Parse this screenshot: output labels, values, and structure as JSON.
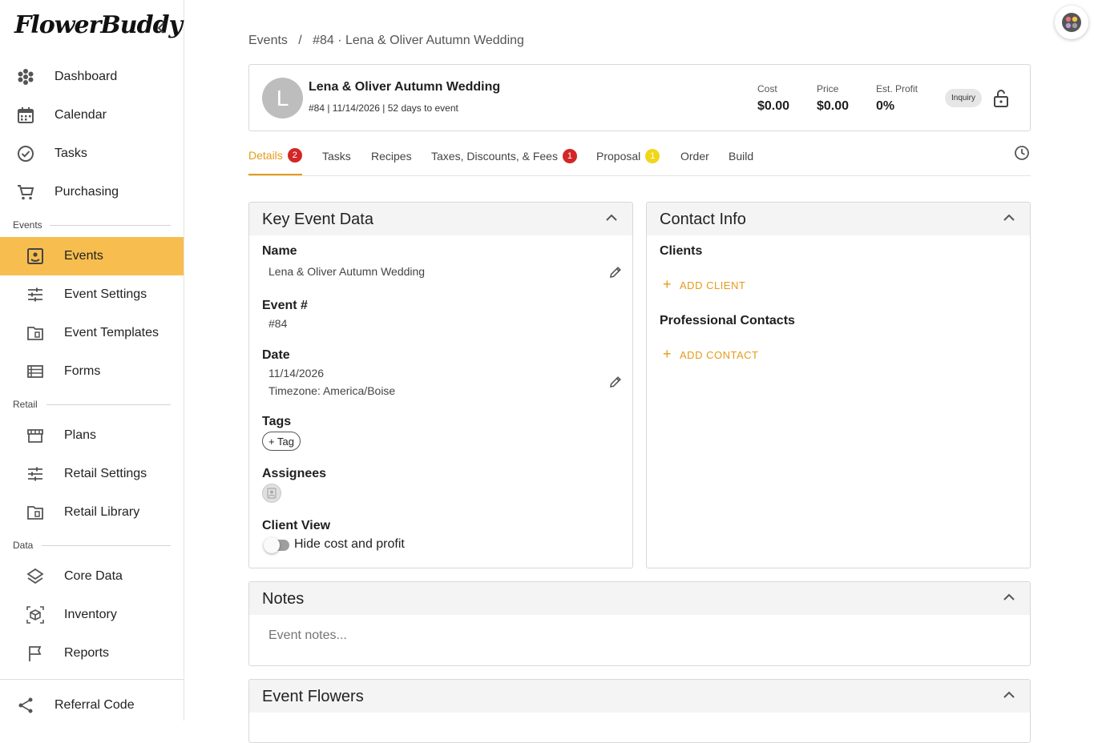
{
  "sidebar": {
    "logo": "FlowerBuddy",
    "top_items": [
      {
        "label": "Dashboard",
        "icon": "flower-icon"
      },
      {
        "label": "Calendar",
        "icon": "calendar-icon"
      },
      {
        "label": "Tasks",
        "icon": "check-circle-icon"
      },
      {
        "label": "Purchasing",
        "icon": "cart-icon"
      }
    ],
    "sections": {
      "events": "Events",
      "retail": "Retail",
      "data": "Data"
    },
    "events_items": [
      {
        "label": "Events",
        "icon": "event-icon",
        "active": true
      },
      {
        "label": "Event Settings",
        "icon": "sliders-icon"
      },
      {
        "label": "Event Templates",
        "icon": "folder-icon"
      },
      {
        "label": "Forms",
        "icon": "list-icon"
      }
    ],
    "retail_items": [
      {
        "label": "Plans",
        "icon": "store-icon"
      },
      {
        "label": "Retail Settings",
        "icon": "sliders-icon"
      },
      {
        "label": "Retail Library",
        "icon": "folder-icon"
      }
    ],
    "data_items": [
      {
        "label": "Core Data",
        "icon": "layers-icon"
      },
      {
        "label": "Inventory",
        "icon": "box-icon"
      },
      {
        "label": "Reports",
        "icon": "flag-icon"
      }
    ],
    "referral": {
      "label": "Referral Code",
      "icon": "share-icon"
    }
  },
  "breadcrumb": {
    "root": "Events",
    "sep": "/",
    "current": "#84 · Lena & Oliver Autumn Wedding"
  },
  "event": {
    "avatar_letter": "L",
    "title": "Lena & Oliver Autumn Wedding",
    "subtitle": "#84 | 11/14/2026 | 52 days to event",
    "cost_label": "Cost",
    "cost_value": "$0.00",
    "price_label": "Price",
    "price_value": "$0.00",
    "profit_label": "Est. Profit",
    "profit_value": "0%",
    "status": "Inquiry"
  },
  "tabs": [
    {
      "label": "Details",
      "badge": "2",
      "badge_color": "red"
    },
    {
      "label": "Tasks"
    },
    {
      "label": "Recipes"
    },
    {
      "label": "Taxes, Discounts, & Fees",
      "badge": "1",
      "badge_color": "red"
    },
    {
      "label": "Proposal",
      "badge": "1",
      "badge_color": "yellow"
    },
    {
      "label": "Order"
    },
    {
      "label": "Build"
    }
  ],
  "key_event": {
    "title": "Key Event Data",
    "name_label": "Name",
    "name_value": "Lena & Oliver Autumn Wedding",
    "number_label": "Event #",
    "number_value": "#84",
    "date_label": "Date",
    "date_value": "11/14/2026",
    "timezone": "Timezone: America/Boise",
    "tags_label": "Tags",
    "tag_button": "+ Tag",
    "assignees_label": "Assignees",
    "client_view_label": "Client View",
    "toggle_label": "Hide cost and profit"
  },
  "contact": {
    "title": "Contact Info",
    "clients_label": "Clients",
    "add_client": "ADD CLIENT",
    "pro_label": "Professional Contacts",
    "add_contact": "ADD CONTACT"
  },
  "notes": {
    "title": "Notes",
    "placeholder": "Event notes..."
  },
  "flowers": {
    "title": "Event Flowers"
  },
  "colors": {
    "accent": "#e59b1a",
    "active_nav": "#f7be4f",
    "badge_red": "#d32626",
    "badge_yellow": "#f2d619"
  }
}
